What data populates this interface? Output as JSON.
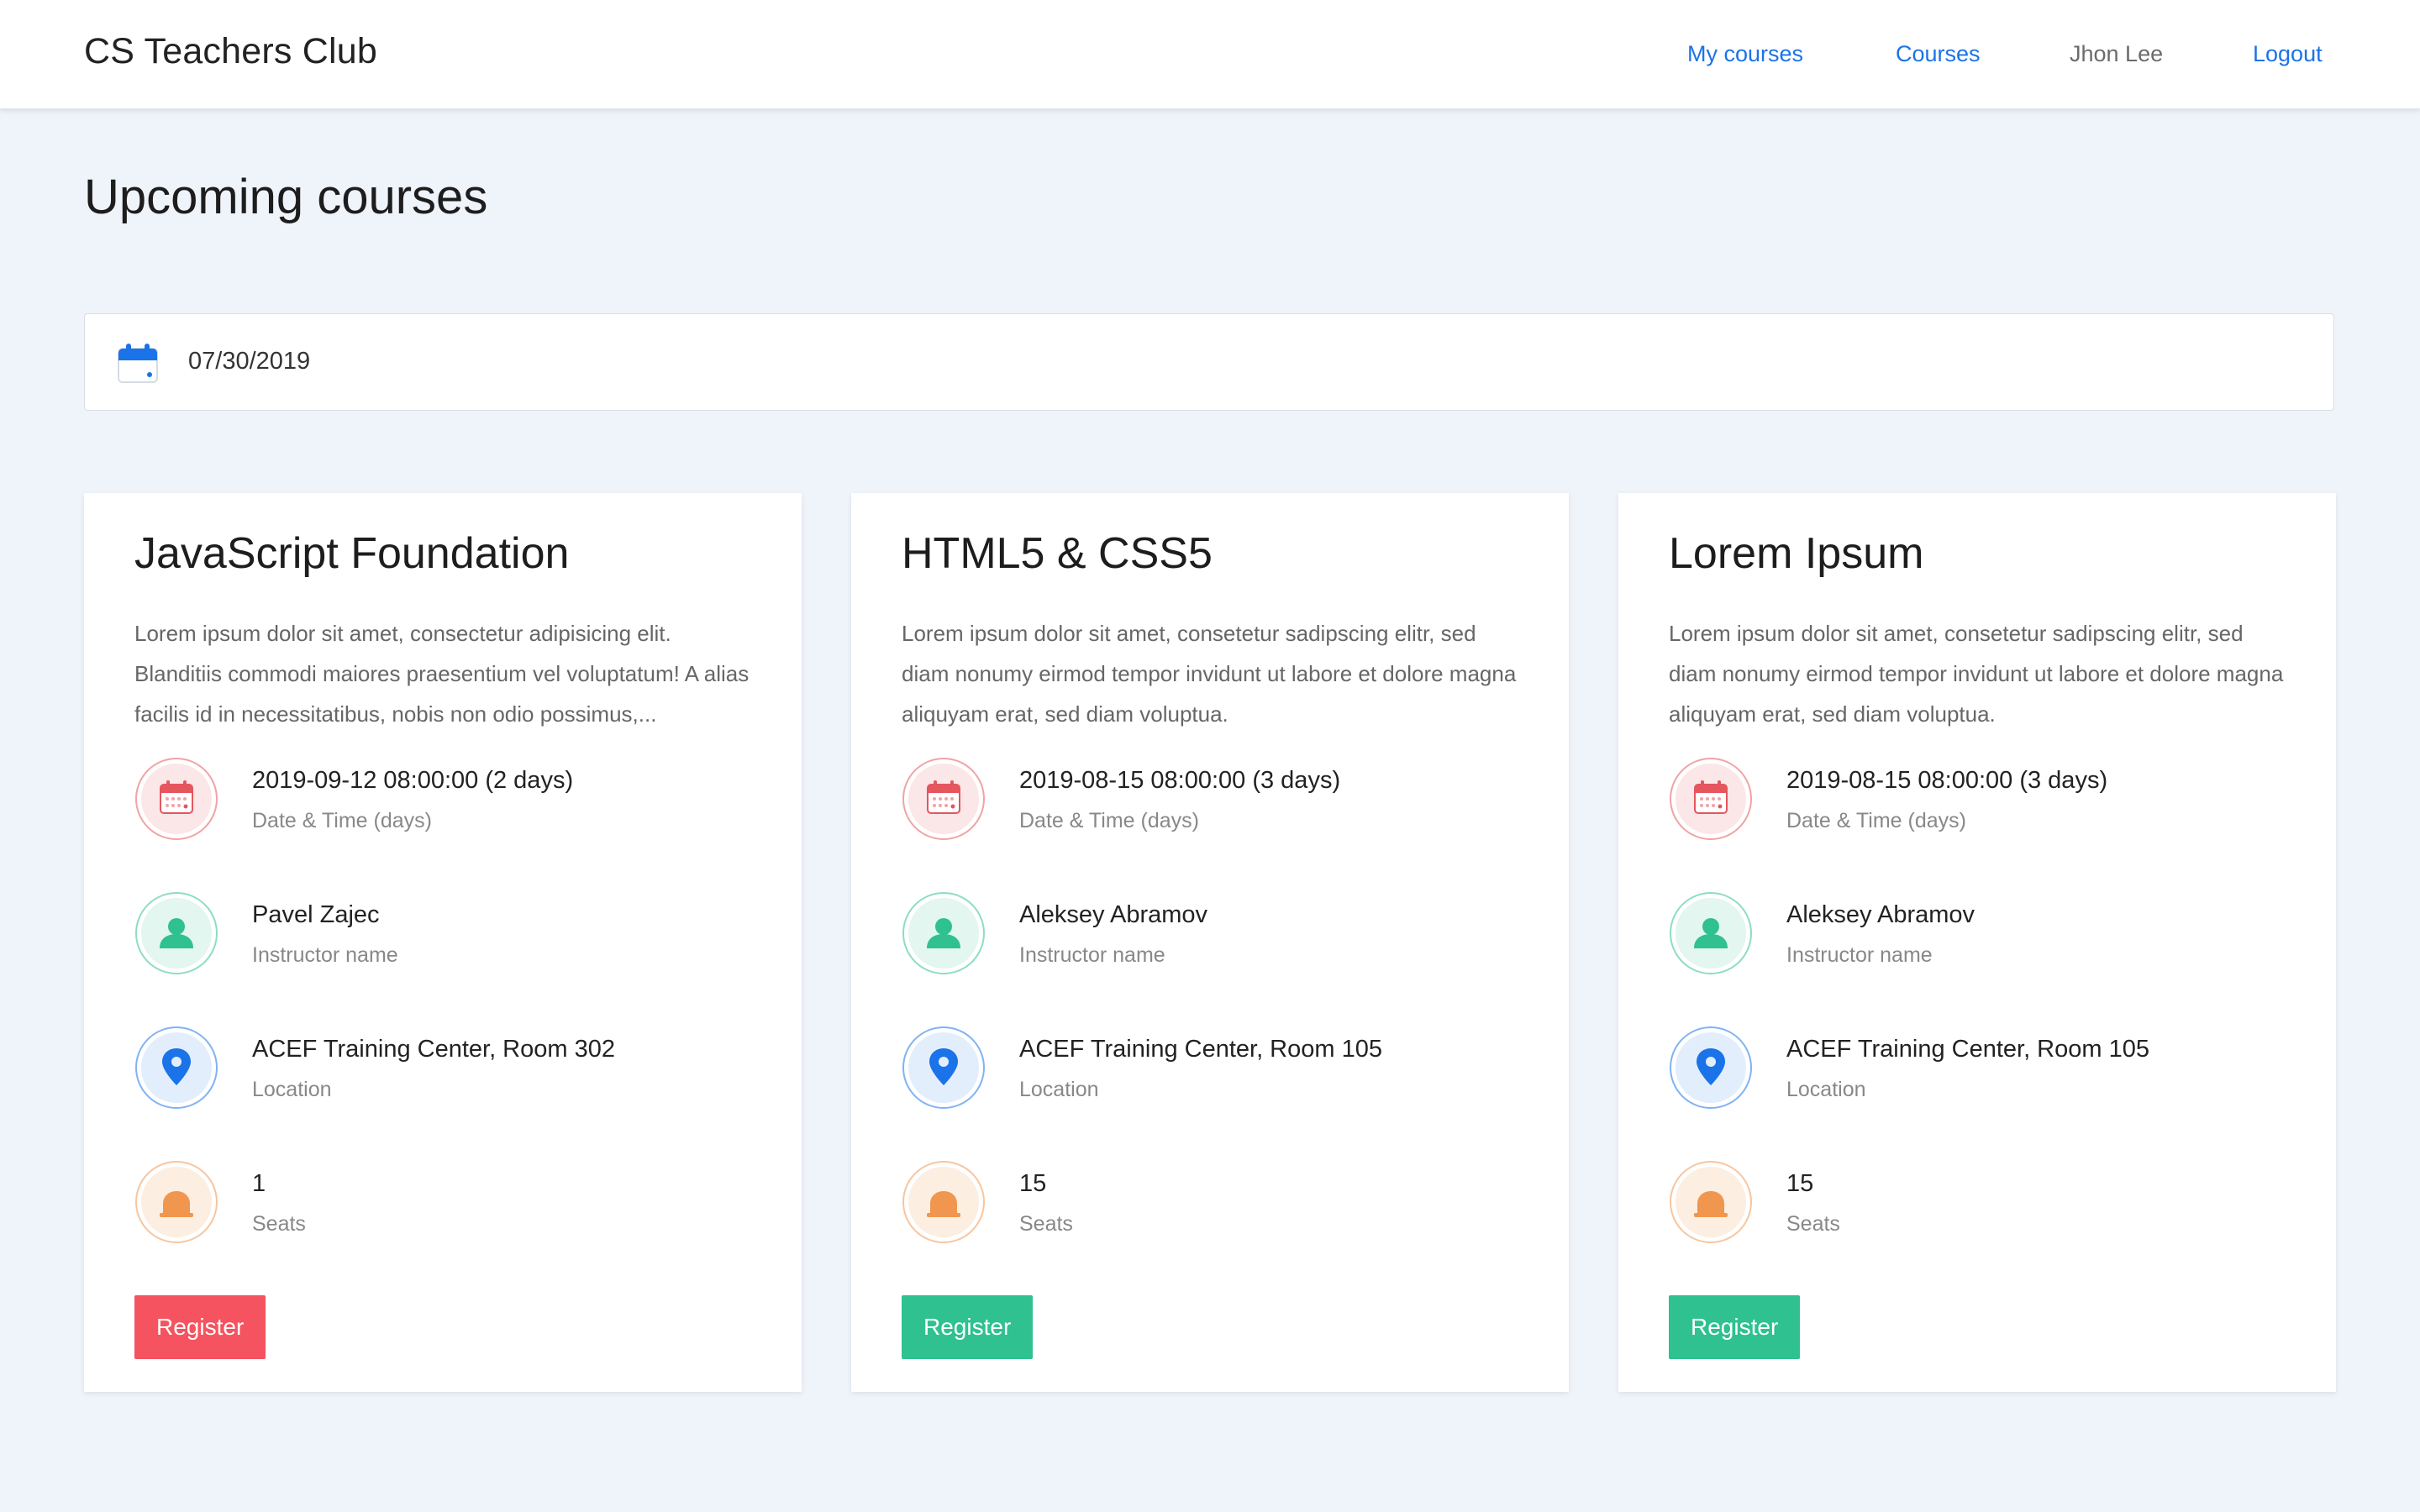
{
  "header": {
    "brand": "CS Teachers Club",
    "nav": {
      "my_courses": "My courses",
      "courses": "Courses",
      "user": "Jhon Lee",
      "logout": "Logout"
    }
  },
  "page": {
    "title": "Upcoming courses"
  },
  "date_filter": {
    "value": "07/30/2019",
    "icon": "calendar-icon"
  },
  "colors": {
    "accent_blue": "#1a73e8",
    "register_red": "#f5535f",
    "register_green": "#2fc190",
    "date_icon": "#e5565f",
    "instructor_icon": "#2fc190",
    "location_icon": "#1a73e8",
    "seats_icon": "#f0964e"
  },
  "labels": {
    "date_time": "Date & Time (days)",
    "instructor": "Instructor name",
    "location": "Location",
    "seats": "Seats",
    "register": "Register"
  },
  "courses": [
    {
      "title": "JavaScript Foundation",
      "description": "Lorem ipsum dolor sit amet, consectetur adipisicing elit. Blanditiis commodi maiores praesentium vel voluptatum! A alias facilis id in necessitatibus, nobis non odio possimus,...",
      "datetime": "2019-09-12 08:00:00 (2 days)",
      "instructor": "Pavel Zajec",
      "location": "ACEF Training Center, Room 302",
      "seats": "1",
      "register_style": "red"
    },
    {
      "title": "HTML5 & CSS5",
      "description": "Lorem ipsum dolor sit amet, consetetur sadipscing elitr, sed diam nonumy eirmod tempor invidunt ut labore et dolore magna aliquyam erat, sed diam voluptua.",
      "datetime": "2019-08-15 08:00:00 (3 days)",
      "instructor": "Aleksey Abramov",
      "location": "ACEF Training Center, Room 105",
      "seats": "15",
      "register_style": "green"
    },
    {
      "title": "Lorem Ipsum",
      "description": "Lorem ipsum dolor sit amet, consetetur sadipscing elitr, sed diam nonumy eirmod tempor invidunt ut labore et dolore magna aliquyam erat, sed diam voluptua.",
      "datetime": "2019-08-15 08:00:00 (3 days)",
      "instructor": "Aleksey Abramov",
      "location": "ACEF Training Center, Room 105",
      "seats": "15",
      "register_style": "green"
    }
  ]
}
